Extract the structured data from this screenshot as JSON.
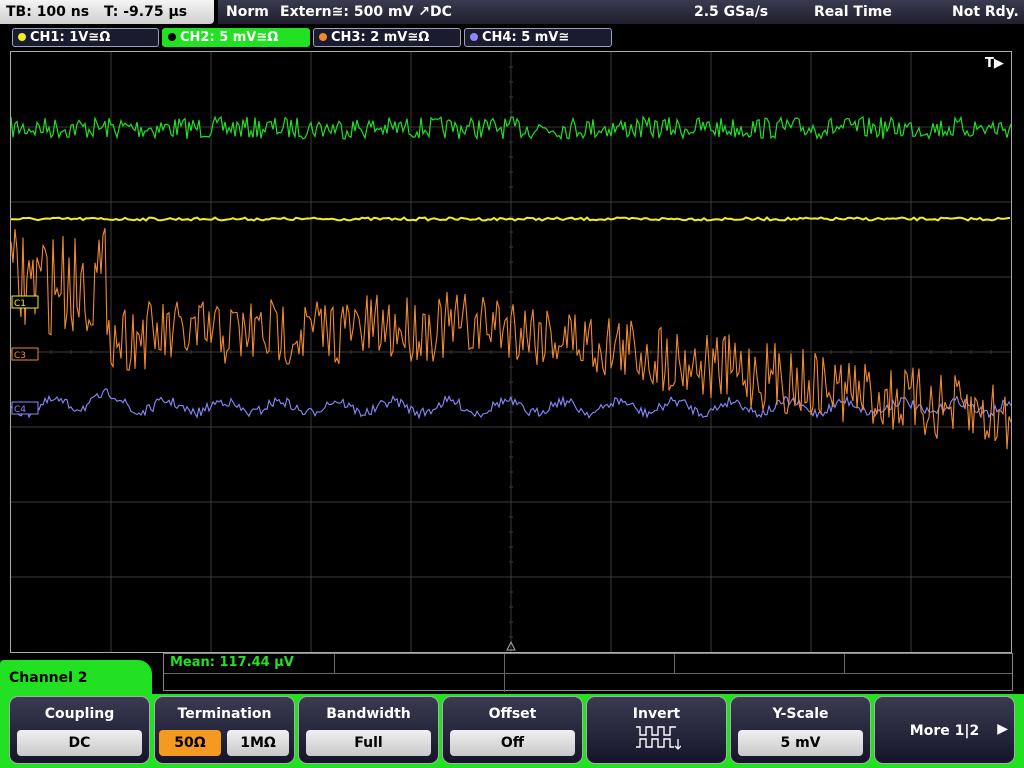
{
  "status": {
    "tb_label": "TB: 100 ns",
    "t_label": "T: -9.75 µs",
    "trigger_mode": "Norm",
    "trigger_source": "Extern≅: 500 mV ↗DC",
    "sample_rate": "2.5 GSa/s",
    "acq_mode": "Real Time",
    "run_state": "Not Rdy."
  },
  "channels": [
    {
      "label": "CH1: 1V≅Ω",
      "color": "#f0f020",
      "active": false
    },
    {
      "label": "CH2: 5 mV≅Ω",
      "color": "#22e022",
      "active": true
    },
    {
      "label": "CH3: 2 mV≅Ω",
      "color": "#f08a30",
      "active": false
    },
    {
      "label": "CH4: 5 mV≅",
      "color": "#8888ff",
      "active": false
    }
  ],
  "markers": {
    "c1": "C1",
    "c3": "C3",
    "c4": "C4",
    "trigger": "T▶"
  },
  "measurement": {
    "text": "Mean: 117.44 µV"
  },
  "menu": {
    "title": "Channel 2",
    "coupling": {
      "label": "Coupling",
      "value": "DC"
    },
    "termination": {
      "label": "Termination",
      "opt1": "50Ω",
      "opt2": "1MΩ",
      "selected": "50Ω"
    },
    "bandwidth": {
      "label": "Bandwidth",
      "value": "Full"
    },
    "offset": {
      "label": "Offset",
      "value": "Off"
    },
    "invert": {
      "label": "Invert"
    },
    "yscale": {
      "label": "Y-Scale",
      "value": "5 mV"
    },
    "more": {
      "label": "More 1|2",
      "arrow": "▶"
    }
  },
  "colors": {
    "ch1": "#f0f020",
    "ch2": "#22e022",
    "ch3": "#f08a30",
    "ch4": "#8888ff",
    "menu_accent": "#22e022"
  }
}
